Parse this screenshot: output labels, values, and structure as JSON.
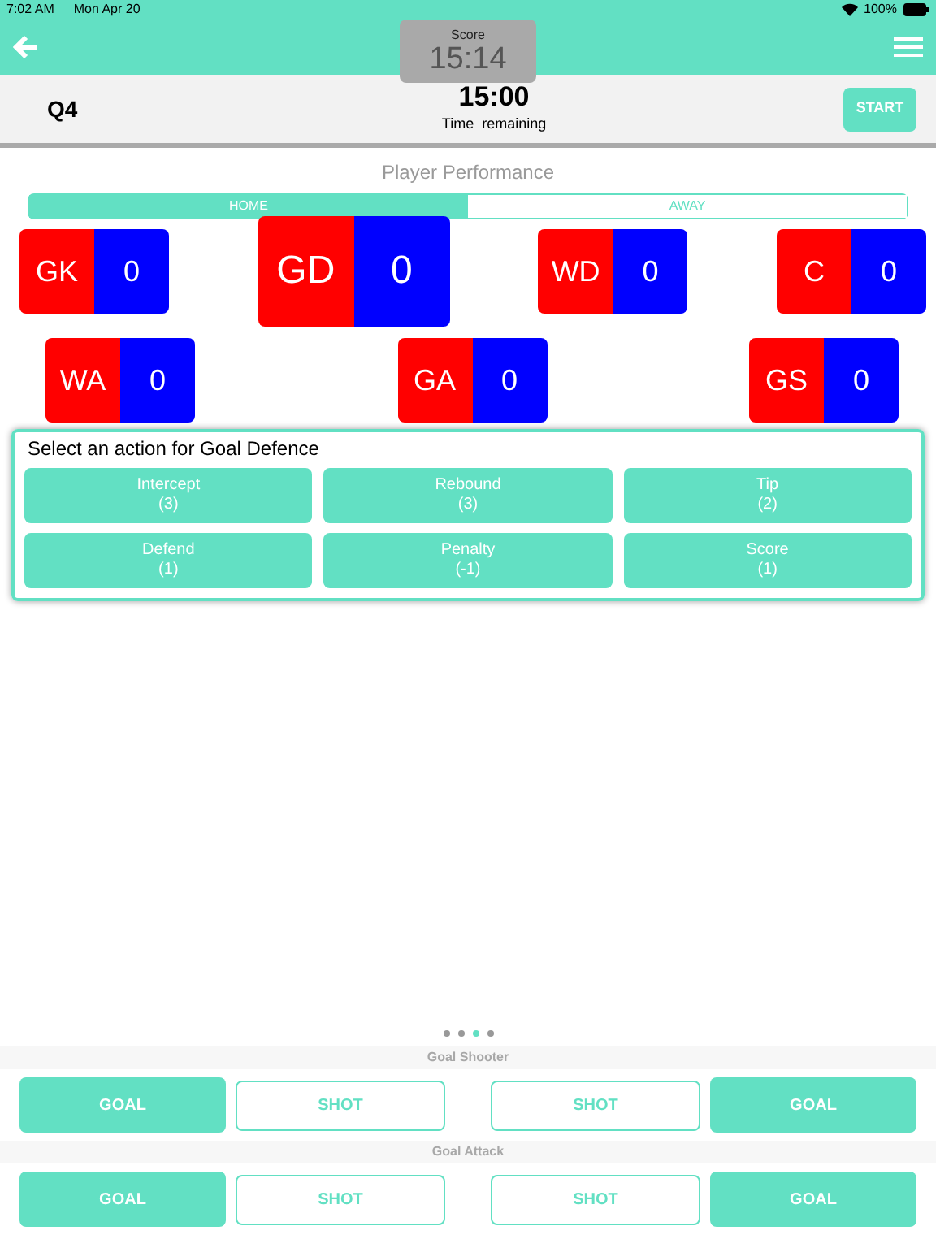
{
  "status_bar": {
    "time": "7:02 AM",
    "date": "Mon Apr 20",
    "battery": "100%"
  },
  "score_overlay": {
    "label": "Score",
    "value": "15:14"
  },
  "quarter_bar": {
    "quarter": "Q4",
    "clock": "15:00",
    "clock_label": "Time  remaining",
    "start_button": "START"
  },
  "section_title": "Player Performance",
  "tabs": [
    {
      "label": "HOME",
      "selected": true
    },
    {
      "label": "AWAY",
      "selected": false
    }
  ],
  "player_rows": [
    [
      {
        "position": "GK",
        "count": "0",
        "selected": false
      },
      {
        "position": "GD",
        "count": "0",
        "selected": true
      },
      {
        "position": "WD",
        "count": "0",
        "selected": false
      },
      {
        "position": "C",
        "count": "0",
        "selected": false
      }
    ],
    [
      {
        "position": "WA",
        "count": "0",
        "selected": false
      },
      {
        "position": "GA",
        "count": "0",
        "selected": false
      },
      {
        "position": "GS",
        "count": "0",
        "selected": false
      }
    ]
  ],
  "action_panel": {
    "title": "Select an action for Goal Defence",
    "actions": [
      {
        "label": "Intercept",
        "points": "(3)"
      },
      {
        "label": "Rebound",
        "points": "(3)"
      },
      {
        "label": "Tip",
        "points": "(2)"
      },
      {
        "label": "Defend",
        "points": "(1)"
      },
      {
        "label": "Penalty",
        "points": "(-1)"
      },
      {
        "label": "Score",
        "points": "(1)"
      }
    ]
  },
  "page_dots": [
    {
      "selected": false
    },
    {
      "selected": false
    },
    {
      "selected": true
    },
    {
      "selected": false
    }
  ],
  "shooting_sections": [
    {
      "title": "Goal Shooter",
      "buttons": [
        {
          "label": "GOAL",
          "kind": "filled"
        },
        {
          "label": "SHOT",
          "kind": "outline"
        },
        {
          "label": "SHOT",
          "kind": "outline"
        },
        {
          "label": "GOAL",
          "kind": "filled"
        }
      ]
    },
    {
      "title": "Goal Attack",
      "buttons": [
        {
          "label": "GOAL",
          "kind": "filled"
        },
        {
          "label": "SHOT",
          "kind": "outline"
        },
        {
          "label": "SHOT",
          "kind": "outline"
        },
        {
          "label": "GOAL",
          "kind": "filled"
        }
      ]
    }
  ]
}
